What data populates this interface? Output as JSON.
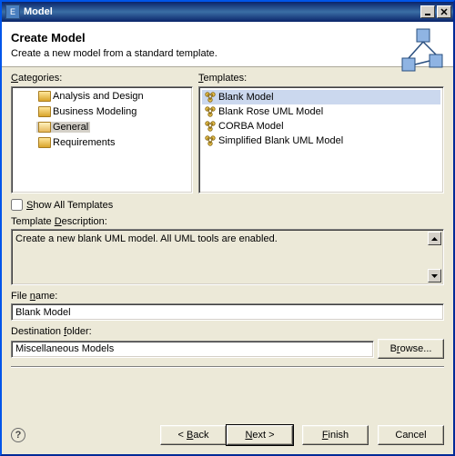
{
  "window": {
    "title": "Model"
  },
  "header": {
    "title": "Create Model",
    "subtitle": "Create a new model from a standard template."
  },
  "labels": {
    "categories": "Categories:",
    "categories_mn": "C",
    "templates": "Templates:",
    "templates_mn": "T",
    "show_all": "Show All Templates",
    "show_all_mn": "S",
    "description": "Template Description:",
    "description_mn": "D",
    "file_name": "File name:",
    "file_name_mn": "n",
    "dest_folder": "Destination folder:",
    "dest_folder_mn": "f"
  },
  "categories": [
    {
      "label": "Analysis and Design",
      "selected": false
    },
    {
      "label": "Business Modeling",
      "selected": false
    },
    {
      "label": "General",
      "selected": true
    },
    {
      "label": "Requirements",
      "selected": false
    }
  ],
  "templates": [
    {
      "label": "Blank Model",
      "selected": true
    },
    {
      "label": "Blank Rose UML Model",
      "selected": false
    },
    {
      "label": "CORBA Model",
      "selected": false
    },
    {
      "label": "Simplified Blank UML Model",
      "selected": false
    }
  ],
  "show_all_checked": false,
  "description_text": "Create a new blank UML model. All UML tools are enabled.",
  "file_name_value": "Blank Model",
  "destination_value": "Miscellaneous Models",
  "buttons": {
    "browse": "Browse...",
    "browse_mn": "r",
    "back": "< Back",
    "back_mn": "B",
    "next": "Next >",
    "next_mn": "N",
    "finish": "Finish",
    "finish_mn": "F",
    "cancel": "Cancel"
  }
}
